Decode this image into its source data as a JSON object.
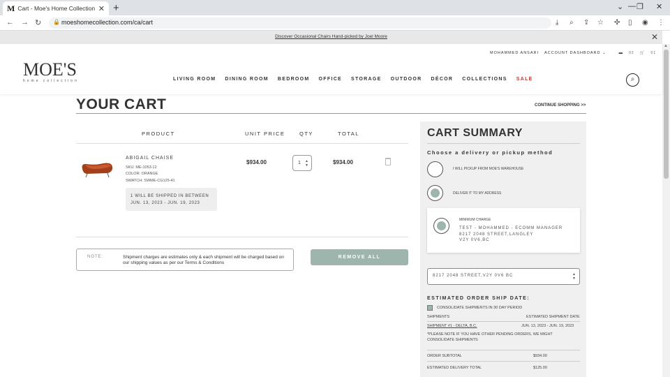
{
  "browser": {
    "tab_title": "Cart - Moe's Home Collection",
    "tab_favicon": "M",
    "url": "moeshomecollection.com/ca/cart"
  },
  "promo": {
    "text": "Discover Occasional Chairs Hand-picked by Joel Moore"
  },
  "header": {
    "logo": "MOE'S",
    "logo_sub": "home collection",
    "user": "MOHAMMED ANSARI",
    "account": "ACCOUNT DASHBOARD",
    "folder_count": "02",
    "cart_count": "01",
    "nav": [
      "LIVING ROOM",
      "DINING ROOM",
      "BEDROOM",
      "OFFICE",
      "STORAGE",
      "OUTDOOR",
      "DÉCOR",
      "COLLECTIONS",
      "SALE"
    ]
  },
  "cart": {
    "title": "YOUR CART",
    "continue": "CONTINUE SHOPPING >>",
    "col_product": "PRODUCT",
    "col_unit_price": "UNIT PRICE",
    "col_qty": "QTY",
    "col_total": "TOTAL",
    "item": {
      "name": "ABIGAIL CHAISE",
      "sku": "SKU: ME-1053-12",
      "color": "COLOR: ORANGE",
      "swatch": "SWATCH: SWME-CG125-41",
      "ship_line1": "1 WILL BE SHIPPED IN BETWEEN",
      "ship_line2": "JUN. 13, 2023 - JUN. 19, 2023",
      "unit_price": "$934.00",
      "qty": "1",
      "total": "$934.00"
    },
    "note_label": "NOTE:",
    "note_text": "Shipment charges are estimates only & each shipment will be charged based on our shipping values as per our Terms & Conditions",
    "remove_all": "REMOVE ALL"
  },
  "summary": {
    "title": "CART SUMMARY",
    "method_heading": "Choose a delivery or pickup method",
    "pickup_label": "I WILL PICKUP FROM MOE'S WAREHOUSE",
    "deliver_label": "DELIVER IT TO MY ADDRESS",
    "min_charge": "MINIMUM CHARGE",
    "addr_line1": "TEST - MOHAMMED - ECOMM MANAGER",
    "addr_line2": "8217 2048 STREET,LANGLEY",
    "addr_line3": "V2Y 0V6,BC",
    "address_select": "8217 2048 STREET,V2Y 0V6 BC",
    "est_heading": "ESTIMATED ORDER SHIP DATE:",
    "consolidate": "CONSOLIDATE SHIPMENTS IN 30 DAY PERIOD",
    "shipments": "SHIPMENTS",
    "est_ship_date": "ESTIMATED SHIPMENT DATE",
    "shipment1": "SHIPMENT #1 - DELTA, B.C.",
    "shipment1_date": "JUN. 13, 2023 - JUN. 19, 2023",
    "pending_note": "*PLEASE NOTE IF YOU HAVE OTHER PENDING ORDERS, WE MIGHT CONSOLIDATE SHIPMENTS",
    "subtotal_label": "ORDER SUBTOTAL",
    "subtotal": "$934.00",
    "delivery_label": "ESTIMATED DELIVERY TOTAL",
    "delivery": "$125.00"
  },
  "colors": {
    "accent": "#9eb5ad",
    "sale": "#c0392b"
  }
}
